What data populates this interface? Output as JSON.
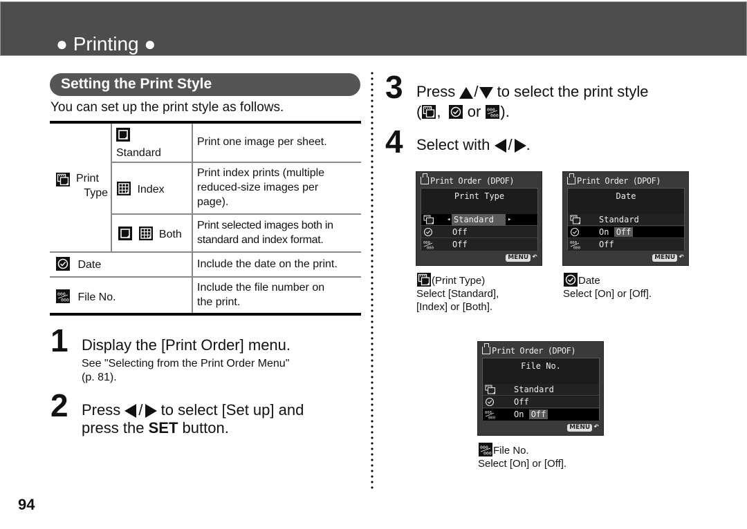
{
  "header": {
    "title": "● Printing ●"
  },
  "section": {
    "title": "Setting the Print Style",
    "intro": "You can set up the print style as follows."
  },
  "table": {
    "group_label_line1": "Print",
    "group_label_line2": "Type",
    "group_icon": "print-type-icon",
    "rows": [
      {
        "option": "Standard",
        "icons": [
          "standard-icon"
        ],
        "description": "Print one image per sheet."
      },
      {
        "option": "Index",
        "icons": [
          "index-icon"
        ],
        "description_lines": [
          "Print index prints (multiple",
          "reduced-size images per",
          "page)."
        ]
      },
      {
        "option": "Both",
        "icons": [
          "standard-icon",
          "index-icon"
        ],
        "description_lines": [
          "Print selected images both in",
          "standard and index format."
        ]
      },
      {
        "option": "Date",
        "icons": [
          "date-icon"
        ],
        "description": "Include the date on the print."
      },
      {
        "option": "File No.",
        "icons": [
          "file-no-icon"
        ],
        "description_lines": [
          "Include the file number on",
          "the print."
        ]
      }
    ]
  },
  "steps": [
    {
      "number": "1",
      "text": "Display the [Print Order] menu.",
      "sub_lines": [
        "See \"Selecting from the Print Order Menu\"",
        "(p. 81)."
      ]
    },
    {
      "number": "2",
      "text_before": "Press",
      "text_after": "to select [Set up] and",
      "line2_before": "press the",
      "line2_bold": "SET",
      "line2_after": "button.",
      "separator": "/"
    },
    {
      "number": "3",
      "text_before": "Press",
      "text_after": "to select the print style",
      "line2_open": "(",
      "line2_sep1": ",",
      "line2_or": "or",
      "line2_close": ").",
      "separator": "/"
    },
    {
      "number": "4",
      "text_before": "Select with",
      "separator": "/",
      "text_after": "."
    }
  ],
  "screens": [
    {
      "title": "Print Order (DPOF)",
      "subtitle": "Print Type",
      "rows": [
        {
          "icon": "print-type-icon",
          "value": "Standard",
          "selected": true,
          "arrows": true
        },
        {
          "icon": "date-icon",
          "value": "Off"
        },
        {
          "icon": "file-no-icon",
          "value": "Off"
        }
      ],
      "menu_label": "MENU",
      "return_glyph": "↶",
      "caption_title": "(Print Type)",
      "caption_lines": [
        "Select [Standard],",
        "[Index] or [Both]."
      ]
    },
    {
      "title": "Print Order (DPOF)",
      "subtitle": "Date",
      "rows": [
        {
          "icon": "print-type-icon",
          "value": "Standard"
        },
        {
          "icon": "date-icon",
          "value_on": "On",
          "value_off": "Off",
          "selected": true
        },
        {
          "icon": "file-no-icon",
          "value": "Off"
        }
      ],
      "menu_label": "MENU",
      "return_glyph": "↶",
      "caption_title": "Date",
      "caption_lines": [
        "Select [On] or [Off]."
      ]
    },
    {
      "title": "Print Order (DPOF)",
      "subtitle": "File No.",
      "rows": [
        {
          "icon": "print-type-icon",
          "value": "Standard"
        },
        {
          "icon": "date-icon",
          "value": "Off"
        },
        {
          "icon": "file-no-icon",
          "value_on": "On",
          "value_off": "Off",
          "selected": true
        }
      ],
      "menu_label": "MENU",
      "return_glyph": "↶",
      "caption_title": "File No.",
      "caption_lines": [
        "Select [On] or [Off]."
      ]
    }
  ],
  "page_number": "94",
  "colors": {
    "header_bg": "#4d4d4d",
    "pill_bg": "#555555",
    "screen_bg": "#3a3a3a"
  }
}
